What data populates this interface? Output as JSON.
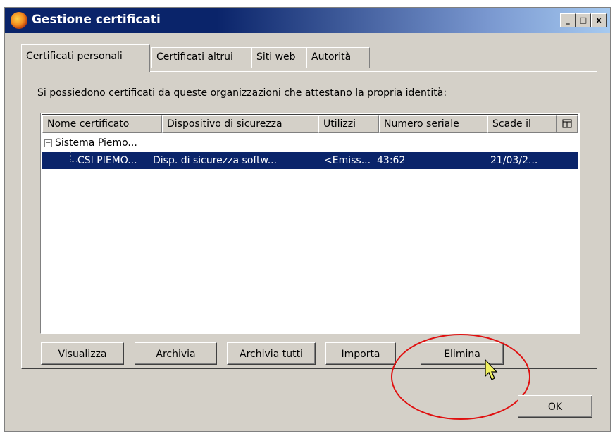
{
  "window": {
    "title": "Gestione certificati"
  },
  "window_buttons": {
    "minimize": "_",
    "maximize": "□",
    "close": "x"
  },
  "tabs": [
    {
      "label": "Certificati personali"
    },
    {
      "label": "Certificati altrui"
    },
    {
      "label": "Siti web"
    },
    {
      "label": "Autorità"
    }
  ],
  "description": "Si possiedono certificati da queste organizzazioni che attestano la propria identità:",
  "columns": [
    "Nome certificato",
    "Dispositivo di sicurezza",
    "Utilizzi",
    "Numero seriale",
    "Scade il"
  ],
  "tree": {
    "group": {
      "expander": "−",
      "label": "Sistema Piemo..."
    },
    "item": {
      "name": "CSI PIEMO...",
      "device": "Disp. di sicurezza softw...",
      "usage": "<Emiss...",
      "serial": "43:62",
      "expires": "21/03/2..."
    }
  },
  "buttons": {
    "view": "Visualizza",
    "backup": "Archivia",
    "backup_all": "Archivia tutti",
    "import": "Importa",
    "delete": "Elimina",
    "ok": "OK"
  },
  "colors": {
    "dialog_bg": "#d4d0c8",
    "title_bar": "#0a246a",
    "selection": "#0a246a",
    "highlight_circle": "#e01010"
  }
}
